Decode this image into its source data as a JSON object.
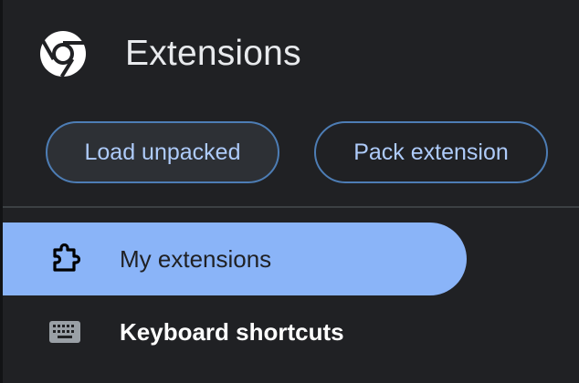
{
  "header": {
    "title": "Extensions",
    "logo_icon": "chrome-logo-icon"
  },
  "toolbar": {
    "load_unpacked_label": "Load unpacked",
    "pack_extension_label": "Pack extension"
  },
  "sidebar": {
    "items": [
      {
        "label": "My extensions",
        "icon": "puzzle-piece-icon",
        "selected": true
      },
      {
        "label": "Keyboard shortcuts",
        "icon": "keyboard-icon",
        "selected": false
      }
    ]
  },
  "colors": {
    "background": "#202124",
    "accent": "#8ab4f8",
    "button_text": "#aecbfa",
    "button_border": "#4d7db5"
  }
}
